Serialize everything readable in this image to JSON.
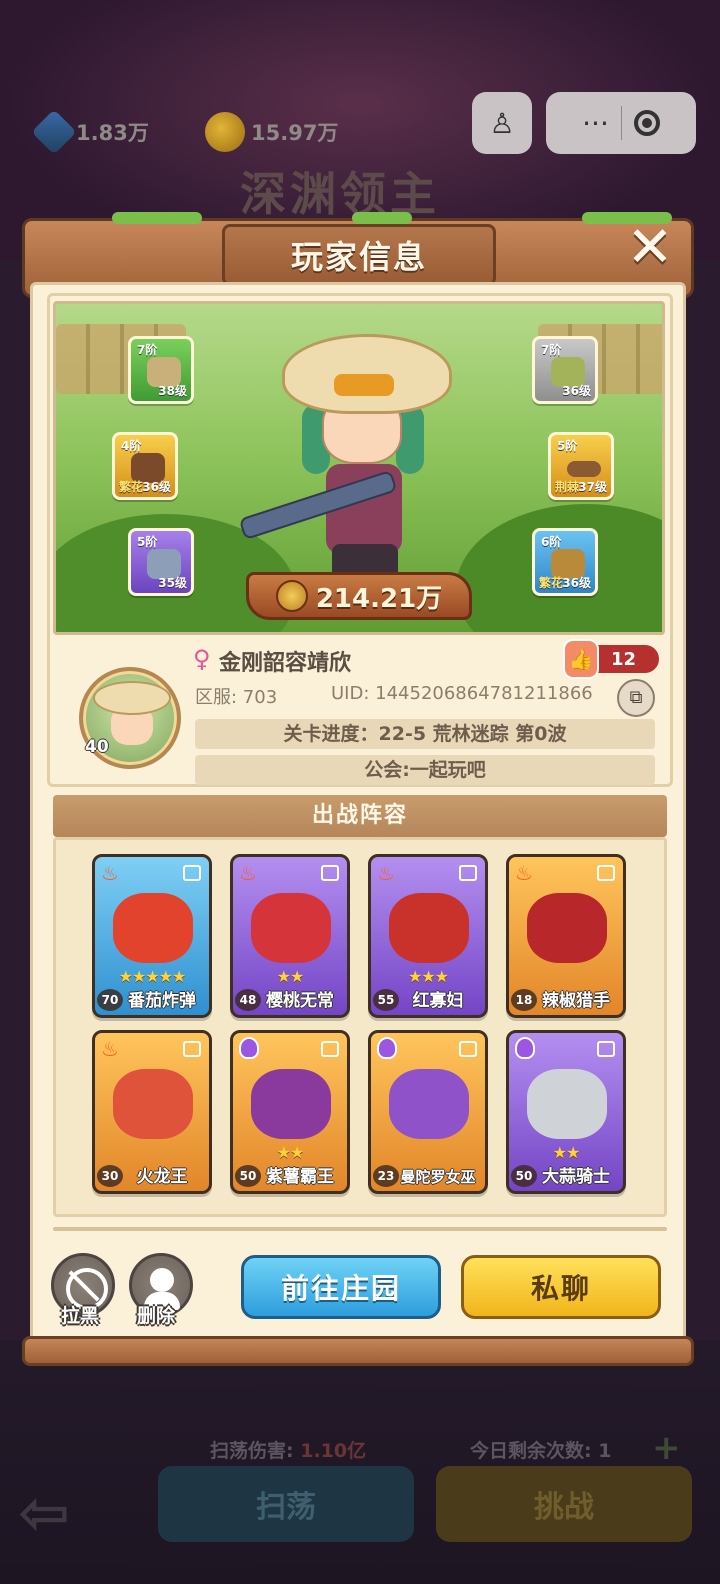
{
  "background": {
    "gems": "1.83万",
    "coins": "15.97万",
    "title": "深渊领主",
    "sweep_damage_label": "扫荡伤害:",
    "sweep_damage_value": "1.10亿",
    "remaining_label": "今日剩余次数: 1",
    "sweep_button": "扫荡",
    "challenge_button": "挑战",
    "back_icon": "back-arrow-icon"
  },
  "system": {
    "more_label": "···"
  },
  "dialog": {
    "title": "玩家信息",
    "close_icon": "✕"
  },
  "hero": {
    "power": "214.21万",
    "equipment": [
      {
        "slot": "hat",
        "tier": "7阶",
        "affix": "",
        "level": "38级",
        "color": "green"
      },
      {
        "slot": "gloves",
        "tier": "4阶",
        "affix": "繁花",
        "level": "36级",
        "color": "gold"
      },
      {
        "slot": "pants",
        "tier": "5阶",
        "affix": "",
        "level": "35级",
        "color": "purple"
      },
      {
        "slot": "armor",
        "tier": "7阶",
        "affix": "",
        "level": "36级",
        "color": "gray"
      },
      {
        "slot": "belt",
        "tier": "5阶",
        "affix": "荆棘",
        "level": "37级",
        "color": "gold"
      },
      {
        "slot": "boots",
        "tier": "6阶",
        "affix": "繁花",
        "level": "36级",
        "color": "blue"
      }
    ]
  },
  "profile": {
    "gender_icon": "♀",
    "name": "金刚韶容靖欣",
    "likes": "12",
    "server": "区服: 703",
    "uid": "UID: 1445206864781211866",
    "level": "40",
    "stage": "关卡进度：22-5  荒林迷踪 第0波",
    "guild": "公会:一起玩吧"
  },
  "lineup": {
    "header": "出战阵容",
    "cards": [
      {
        "name": "番茄炸弹",
        "level": "70",
        "stars": "★★★★★",
        "color": "blue"
      },
      {
        "name": "樱桃无常",
        "level": "48",
        "stars": "★★",
        "color": "purple"
      },
      {
        "name": "红寡妇",
        "level": "55",
        "stars": "★★★",
        "color": "purple"
      },
      {
        "name": "辣椒猎手",
        "level": "18",
        "stars": "",
        "color": "orange"
      },
      {
        "name": "火龙王",
        "level": "30",
        "stars": "",
        "color": "orange"
      },
      {
        "name": "紫薯霸王",
        "level": "50",
        "stars": "★★",
        "color": "orange"
      },
      {
        "name": "曼陀罗女巫",
        "level": "23",
        "stars": "",
        "color": "orange"
      },
      {
        "name": "大蒜骑士",
        "level": "50",
        "stars": "★★",
        "color": "purple"
      }
    ]
  },
  "actions": {
    "block_label": "拉黑",
    "delete_label": "删除",
    "go_farm": "前往庄园",
    "private_chat": "私聊"
  }
}
